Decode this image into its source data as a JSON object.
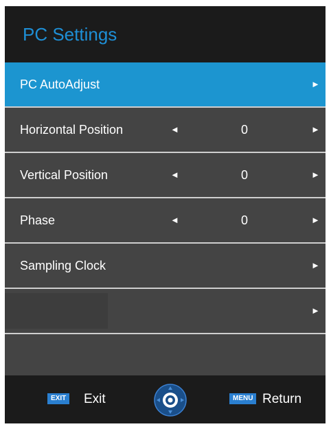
{
  "title": "PC Settings",
  "rows": [
    {
      "label": "PC AutoAdjust",
      "right_arrow": "►"
    },
    {
      "label": "Horizontal Position",
      "left_arrow": "◄",
      "value": "0",
      "right_arrow": "►"
    },
    {
      "label": "Vertical Position",
      "left_arrow": "◄",
      "value": "0",
      "right_arrow": "►"
    },
    {
      "label": "Phase",
      "left_arrow": "◄",
      "value": "0",
      "right_arrow": "►"
    },
    {
      "label": "Sampling Clock",
      "right_arrow": "►"
    },
    {
      "right_arrow": "►"
    }
  ],
  "footer": {
    "exit_key": "EXIT",
    "exit_label": "Exit",
    "menu_key": "MENU",
    "return_label": "Return",
    "nav_icon": "navigation-dpad-icon"
  },
  "colors": {
    "accent": "#1c95d0",
    "title": "#1e8fd6",
    "row_bg": "#444444",
    "panel_bg": "#1b1b1b",
    "key_bg": "#2a7fd0"
  }
}
